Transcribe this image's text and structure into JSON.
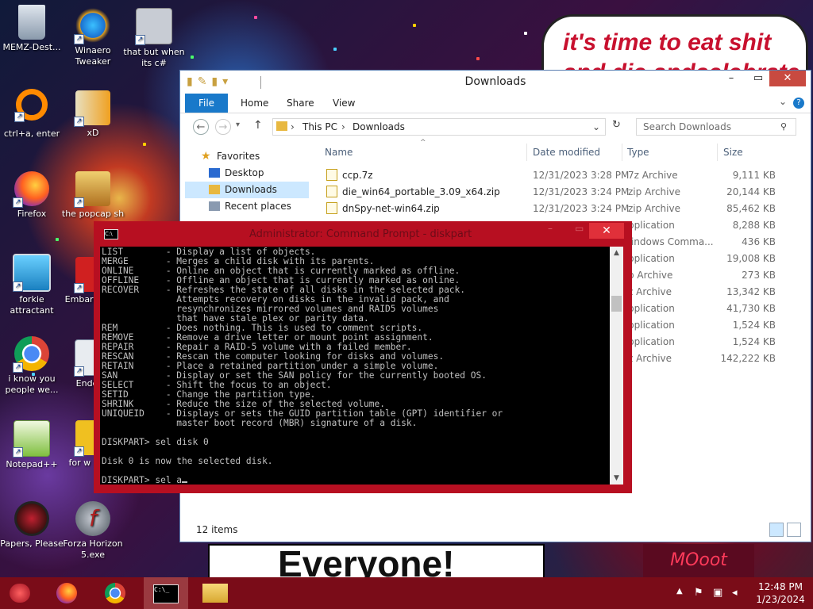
{
  "desktop": {
    "speech_bubble": [
      "it's time to eat shit",
      "and die andcelebrate"
    ],
    "banner_text": "Everyone!",
    "sign_text": "MOoot",
    "icons": [
      {
        "label": "MEMZ-Dest...",
        "icon": "recycle-bin-icon"
      },
      {
        "label": "Winaero Tweaker",
        "icon": "winaero-icon"
      },
      {
        "label": "that but when its c#",
        "icon": "stack-icon"
      },
      {
        "label": "ctrl+a, enter",
        "icon": "ring-icon"
      },
      {
        "label": "xD",
        "icon": "hxd-icon"
      },
      {
        "label": "Firefox",
        "icon": "firefox-icon"
      },
      {
        "label": "the popcap sh",
        "icon": "popcap-icon"
      },
      {
        "label": "forkie attractant",
        "icon": "settings-monitor-icon"
      },
      {
        "label": "Embarc Dev-",
        "icon": "embarcadero-icon"
      },
      {
        "label": "i know you people we...",
        "icon": "chrome-icon"
      },
      {
        "label": "Enderm",
        "icon": "window-icon"
      },
      {
        "label": "Notepad++",
        "icon": "notepadpp-icon"
      },
      {
        "label": "for w some",
        "icon": "dj-icon"
      },
      {
        "label": "Papers, Please",
        "icon": "papers-please-icon"
      },
      {
        "label": "Forza Horizon 5.exe",
        "icon": "flash-icon"
      }
    ]
  },
  "explorer": {
    "title": "Downloads",
    "ribbon_tabs": [
      "File",
      "Home",
      "Share",
      "View"
    ],
    "address": [
      "This PC",
      "Downloads"
    ],
    "search_placeholder": "Search Downloads",
    "nav": {
      "favorites": "Favorites",
      "items": [
        "Desktop",
        "Downloads",
        "Recent places"
      ]
    },
    "columns": {
      "name": "Name",
      "date": "Date modified",
      "type": "Type",
      "size": "Size"
    },
    "files": [
      {
        "name": "ccp.7z",
        "date": "12/31/2023 3:28 PM",
        "type": "7z Archive",
        "size": "9,111 KB"
      },
      {
        "name": "die_win64_portable_3.09_x64.zip",
        "date": "12/31/2023 3:24 PM",
        "type": "zip Archive",
        "size": "20,144 KB"
      },
      {
        "name": "dnSpy-net-win64.zip",
        "date": "12/31/2023 3:24 PM",
        "type": "zip Archive",
        "size": "85,462 KB"
      }
    ],
    "hidden_rows": [
      {
        "type": "pplication",
        "size": "8,288 KB"
      },
      {
        "type": "Vindows Comma...",
        "size": "436 KB"
      },
      {
        "type": "pplication",
        "size": "19,008 KB"
      },
      {
        "type": "p Archive",
        "size": "273 KB"
      },
      {
        "type": "z Archive",
        "size": "13,342 KB"
      },
      {
        "type": "pplication",
        "size": "41,730 KB"
      },
      {
        "type": "pplication",
        "size": "1,524 KB"
      },
      {
        "type": "pplication",
        "size": "1,524 KB"
      },
      {
        "type": "z Archive",
        "size": "142,222 KB"
      }
    ],
    "status": "12 items"
  },
  "cmd": {
    "title": "Administrator: Command Prompt - diskpart",
    "close_glyph": "✕",
    "lines": [
      "LIST        - Display a list of objects.",
      "MERGE       - Merges a child disk with its parents.",
      "ONLINE      - Online an object that is currently marked as offline.",
      "OFFLINE     - Offline an object that is currently marked as online.",
      "RECOVER     - Refreshes the state of all disks in the selected pack.",
      "              Attempts recovery on disks in the invalid pack, and",
      "              resynchronizes mirrored volumes and RAID5 volumes",
      "              that have stale plex or parity data.",
      "REM         - Does nothing. This is used to comment scripts.",
      "REMOVE      - Remove a drive letter or mount point assignment.",
      "REPAIR      - Repair a RAID-5 volume with a failed member.",
      "RESCAN      - Rescan the computer looking for disks and volumes.",
      "RETAIN      - Place a retained partition under a simple volume.",
      "SAN         - Display or set the SAN policy for the currently booted OS.",
      "SELECT      - Shift the focus to an object.",
      "SETID       - Change the partition type.",
      "SHRINK      - Reduce the size of the selected volume.",
      "UNIQUEID    - Displays or sets the GUID partition table (GPT) identifier or",
      "              master boot record (MBR) signature of a disk.",
      "",
      "DISKPART> sel disk 0",
      "",
      "Disk 0 is now the selected disk.",
      "",
      "DISKPART> sel a"
    ]
  },
  "taskbar": {
    "clock_time": "12:48 PM",
    "clock_date": "1/23/2024"
  }
}
